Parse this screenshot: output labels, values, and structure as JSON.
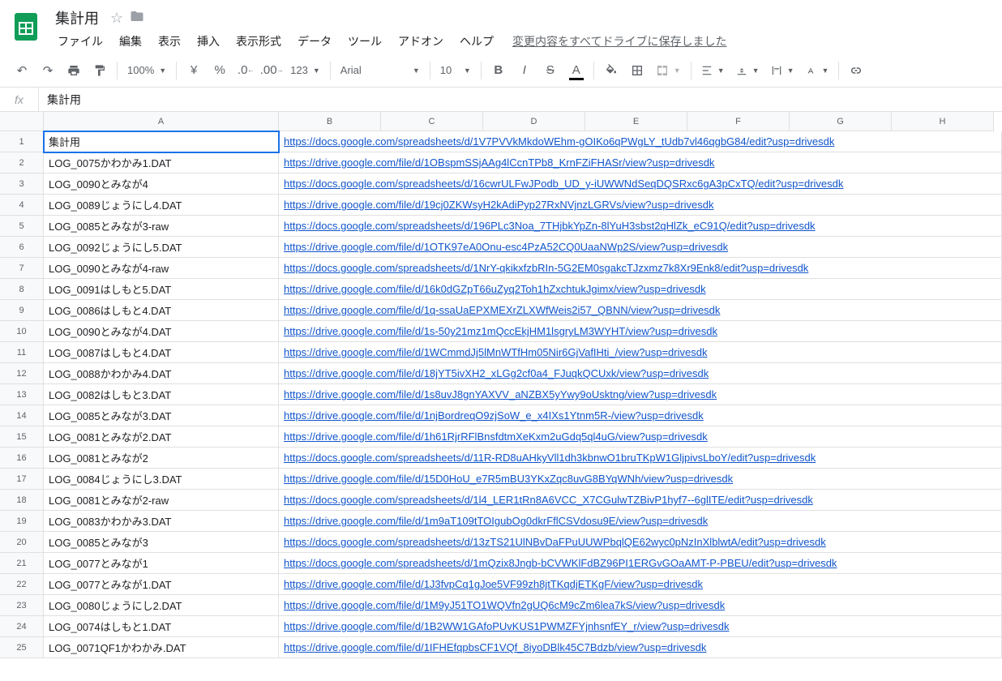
{
  "doc_title": "集計用",
  "menu": [
    "ファイル",
    "編集",
    "表示",
    "挿入",
    "表示形式",
    "データ",
    "ツール",
    "アドオン",
    "ヘルプ"
  ],
  "save_status": "変更内容をすべてドライブに保存しました",
  "toolbar": {
    "zoom": "100%",
    "currency_symbol": "¥",
    "percent": "%",
    "dec_dec": ".0",
    "inc_dec": ".00",
    "num_fmt": "123",
    "font": "Arial",
    "font_size": "10"
  },
  "fx_value": "集計用",
  "columns": [
    "A",
    "B",
    "C",
    "D",
    "E",
    "F",
    "G",
    "H"
  ],
  "rows": [
    {
      "n": "1",
      "a": "集計用",
      "b": "https://docs.google.com/spreadsheets/d/1V7PVVkMkdoWEhm-gOIKo6qPWgLY_tUdb7vl46qgbG84/edit?usp=drivesdk",
      "sel": true
    },
    {
      "n": "2",
      "a": "LOG_0075かわかみ1.DAT",
      "b": "https://drive.google.com/file/d/1OBspmSSjAAg4lCcnTPb8_KrnFZiFHASr/view?usp=drivesdk"
    },
    {
      "n": "3",
      "a": "LOG_0090とみなが4",
      "b": "https://docs.google.com/spreadsheets/d/16cwrULFwJPodb_UD_y-iUWWNdSeqDQSRxc6gA3pCxTQ/edit?usp=drivesdk"
    },
    {
      "n": "4",
      "a": "LOG_0089じょうにし4.DAT",
      "b": "https://drive.google.com/file/d/19cj0ZKWsyH2kAdiPyp27RxNVjnzLGRVs/view?usp=drivesdk"
    },
    {
      "n": "5",
      "a": "LOG_0085とみなが3-raw",
      "b": "https://docs.google.com/spreadsheets/d/196PLc3Noa_7THjbkYpZn-8lYuH3sbst2qHlZk_eC91Q/edit?usp=drivesdk"
    },
    {
      "n": "6",
      "a": "LOG_0092じょうにし5.DAT",
      "b": "https://drive.google.com/file/d/1OTK97eA0Onu-esc4PzA52CQ0UaaNWp2S/view?usp=drivesdk"
    },
    {
      "n": "7",
      "a": "LOG_0090とみなが4-raw",
      "b": "https://docs.google.com/spreadsheets/d/1NrY-qkikxfzbRIn-5G2EM0sgakcTJzxmz7k8Xr9Enk8/edit?usp=drivesdk"
    },
    {
      "n": "8",
      "a": "LOG_0091はしもと5.DAT",
      "b": "https://drive.google.com/file/d/16k0dGZpT66uZyq2Toh1hZxchtukJgimx/view?usp=drivesdk"
    },
    {
      "n": "9",
      "a": "LOG_0086はしもと4.DAT",
      "b": "https://drive.google.com/file/d/1q-ssaUaEPXMEXrZLXWfWeis2i57_QBNN/view?usp=drivesdk"
    },
    {
      "n": "10",
      "a": "LOG_0090とみなが4.DAT",
      "b": "https://drive.google.com/file/d/1s-50y21mz1mQccEkjHM1lsgryLM3WYHT/view?usp=drivesdk"
    },
    {
      "n": "11",
      "a": "LOG_0087はしもと4.DAT",
      "b": "https://drive.google.com/file/d/1WCmmdJj5lMnWTfHm05Nir6GjVafIHti_/view?usp=drivesdk"
    },
    {
      "n": "12",
      "a": "LOG_0088かわかみ4.DAT",
      "b": "https://drive.google.com/file/d/18jYT5ivXH2_xLGg2cf0a4_FJuqkQCUxk/view?usp=drivesdk"
    },
    {
      "n": "13",
      "a": "LOG_0082はしもと3.DAT",
      "b": "https://drive.google.com/file/d/1s8uvJ8gnYAXVV_aNZBX5yYwy9oUsktng/view?usp=drivesdk"
    },
    {
      "n": "14",
      "a": "LOG_0085とみなが3.DAT",
      "b": "https://drive.google.com/file/d/1njBordreqO9zjSoW_e_x4IXs1Ytnm5R-/view?usp=drivesdk"
    },
    {
      "n": "15",
      "a": "LOG_0081とみなが2.DAT",
      "b": "https://drive.google.com/file/d/1h61RjrRFlBnsfdtmXeKxm2uGdq5ql4uG/view?usp=drivesdk"
    },
    {
      "n": "16",
      "a": "LOG_0081とみなが2",
      "b": "https://docs.google.com/spreadsheets/d/11R-RD8uAHkyVll1dh3kbnwO1bruTKpW1GljpivsLboY/edit?usp=drivesdk"
    },
    {
      "n": "17",
      "a": "LOG_0084じょうにし3.DAT",
      "b": "https://drive.google.com/file/d/15D0HoU_e7R5mBU3YKxZqc8uvG8BYqWNh/view?usp=drivesdk"
    },
    {
      "n": "18",
      "a": "LOG_0081とみなが2-raw",
      "b": "https://docs.google.com/spreadsheets/d/1l4_LER1tRn8A6VCC_X7CGulwTZBivP1hyf7--6glITE/edit?usp=drivesdk"
    },
    {
      "n": "19",
      "a": "LOG_0083かわかみ3.DAT",
      "b": "https://drive.google.com/file/d/1m9aT109tTOIgubOg0dkrFflCSVdosu9E/view?usp=drivesdk"
    },
    {
      "n": "20",
      "a": "LOG_0085とみなが3",
      "b": "https://docs.google.com/spreadsheets/d/13zTS21UlNBvDaFPuUUWPbqlQE62wyc0pNzInXlblwtA/edit?usp=drivesdk"
    },
    {
      "n": "21",
      "a": "LOG_0077とみなが1",
      "b": "https://docs.google.com/spreadsheets/d/1mQzix8Jngb-bCVWKlFdBZ96PI1ERGvGOaAMT-P-PBEU/edit?usp=drivesdk"
    },
    {
      "n": "22",
      "a": "LOG_0077とみなが1.DAT",
      "b": "https://drive.google.com/file/d/1J3fvpCq1gJoe5VF99zh8jtTKqdjETKgF/view?usp=drivesdk"
    },
    {
      "n": "23",
      "a": "LOG_0080じょうにし2.DAT",
      "b": "https://drive.google.com/file/d/1M9yJ51TO1WQVfn2gUQ6cM9cZm6lea7kS/view?usp=drivesdk"
    },
    {
      "n": "24",
      "a": "LOG_0074はしもと1.DAT",
      "b": "https://drive.google.com/file/d/1B2WW1GAfoPUvKUS1PWMZFYjnhsnfEY_r/view?usp=drivesdk"
    },
    {
      "n": "25",
      "a": "LOG_0071QF1かわかみ.DAT",
      "b": "https://drive.google.com/file/d/1IFHEfqpbsCF1VQf_8iyoDBlk45C7Bdzb/view?usp=drivesdk"
    }
  ]
}
